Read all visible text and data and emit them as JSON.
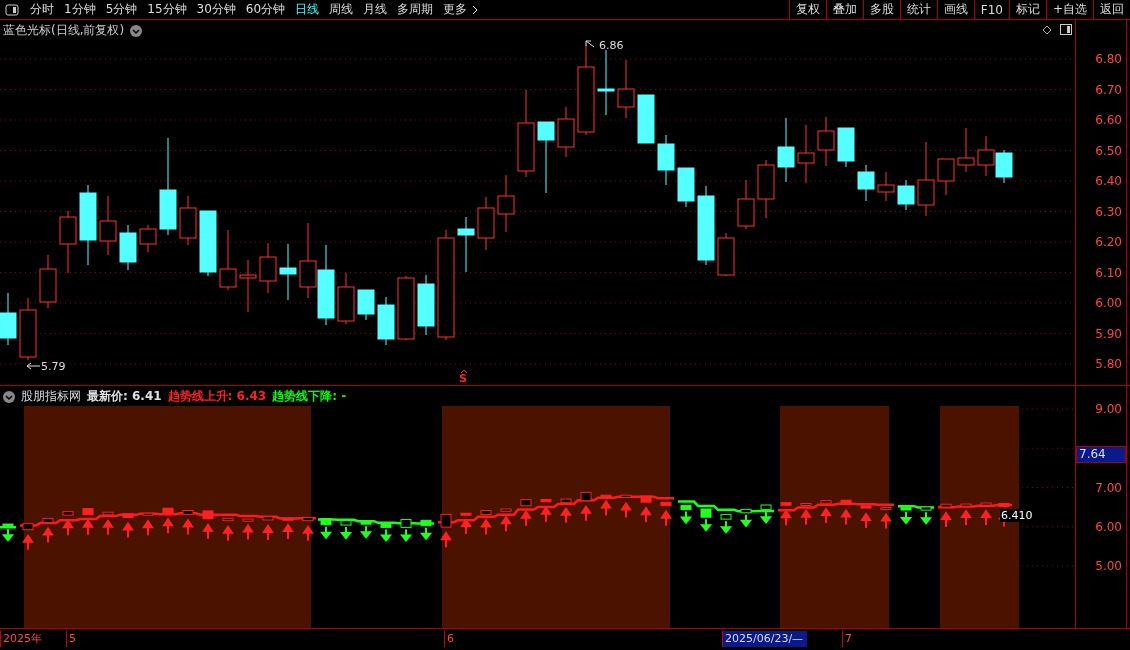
{
  "toolbar": {
    "periods": [
      {
        "label": "分时",
        "selected": false
      },
      {
        "label": "1分钟",
        "selected": false
      },
      {
        "label": "5分钟",
        "selected": false
      },
      {
        "label": "15分钟",
        "selected": false
      },
      {
        "label": "30分钟",
        "selected": false
      },
      {
        "label": "60分钟",
        "selected": false
      },
      {
        "label": "日线",
        "selected": true
      },
      {
        "label": "周线",
        "selected": false
      },
      {
        "label": "月线",
        "selected": false
      },
      {
        "label": "多周期",
        "selected": false
      },
      {
        "label": "更多",
        "selected": false
      }
    ],
    "buttons": [
      "复权",
      "叠加",
      "多股",
      "统计",
      "画线",
      "F10",
      "标记",
      "+自选",
      "返回"
    ]
  },
  "price_chart": {
    "title": "蓝色光标(日线,前复权)",
    "high_label": "6.86",
    "low_label": "5.79",
    "signal_label": "S",
    "axis": [
      "6.80",
      "6.70",
      "6.60",
      "6.50",
      "6.40",
      "6.30",
      "6.20",
      "6.10",
      "6.00",
      "5.90",
      "5.80"
    ]
  },
  "indicator": {
    "name": "股朋指标网",
    "readouts": [
      {
        "text": "最新价: 6.41",
        "color": "#e0e0e0"
      },
      {
        "text": "趋势线上升: 6.43",
        "color": "#ff2020"
      },
      {
        "text": "趋势线下降: -",
        "color": "#00ff00"
      }
    ],
    "value_label": "6.410",
    "axis": [
      {
        "kind": "tick",
        "text": "9.00"
      },
      {
        "kind": "cursor",
        "text": "7.64"
      },
      {
        "kind": "tick",
        "text": "7.00"
      },
      {
        "kind": "tick",
        "text": "6.00"
      },
      {
        "kind": "tick",
        "text": "5.00"
      }
    ]
  },
  "time_axis": [
    {
      "kind": "tick",
      "text": "2025年"
    },
    {
      "kind": "tick",
      "text": "5"
    },
    {
      "kind": "tick",
      "text": "6"
    },
    {
      "kind": "cursor",
      "text": "2025/06/23/—"
    },
    {
      "kind": "tick",
      "text": "7"
    }
  ]
}
